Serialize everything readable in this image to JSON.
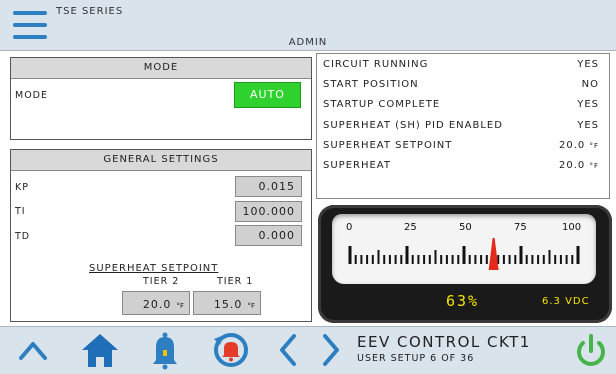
{
  "header": {
    "series": "TSE SERIES",
    "user": "ADMIN"
  },
  "mode_panel": {
    "title": "MODE",
    "mode_label": "MODE",
    "mode_value": "AUTO"
  },
  "general_settings": {
    "title": "GENERAL SETTINGS",
    "rows": [
      {
        "label": "KP",
        "value": "0.015"
      },
      {
        "label": "TI",
        "value": "100.000"
      },
      {
        "label": "TD",
        "value": "0.000"
      }
    ],
    "superheat_setpoint": {
      "title": "SUPERHEAT SETPOINT",
      "tier2_label": "TIER 2",
      "tier1_label": "TIER 1",
      "tier2_value": "20.0",
      "tier1_value": "15.0",
      "unit": "°F"
    }
  },
  "status": [
    {
      "label": "CIRCUIT RUNNING",
      "value": "YES"
    },
    {
      "label": "START POSITION",
      "value": "NO"
    },
    {
      "label": "STARTUP COMPLETE",
      "value": "YES"
    },
    {
      "label": "SUPERHEAT (SH) PID ENABLED",
      "value": "YES"
    },
    {
      "label": "SUPERHEAT SETPOINT",
      "value": "20.0",
      "unit": "°F"
    },
    {
      "label": "SUPERHEAT",
      "value": "20.0",
      "unit": "°F"
    }
  ],
  "gauge": {
    "scale_labels": [
      "0",
      "25",
      "50",
      "75",
      "100"
    ],
    "percent_text": "63%",
    "percent_value": 63,
    "voltage_text": "6.3 VDC"
  },
  "footer": {
    "title": "EEV CONTROL CKT1",
    "subtitle": "USER SETUP 6 OF 36",
    "icons": [
      "chevron-up-icon",
      "home-icon",
      "bell-icon",
      "alarm-reset-icon",
      "chevron-left-icon",
      "chevron-right-icon",
      "power-icon"
    ]
  },
  "colors": {
    "accent_blue": "#2d7fc1",
    "auto_green": "#2fd12f",
    "gauge_yellow": "#f5e400",
    "needle_red": "#e52a1c",
    "alarm_red": "#e53b2a",
    "bell_blue": "#2d7fc1",
    "power_green": "#46b549"
  }
}
